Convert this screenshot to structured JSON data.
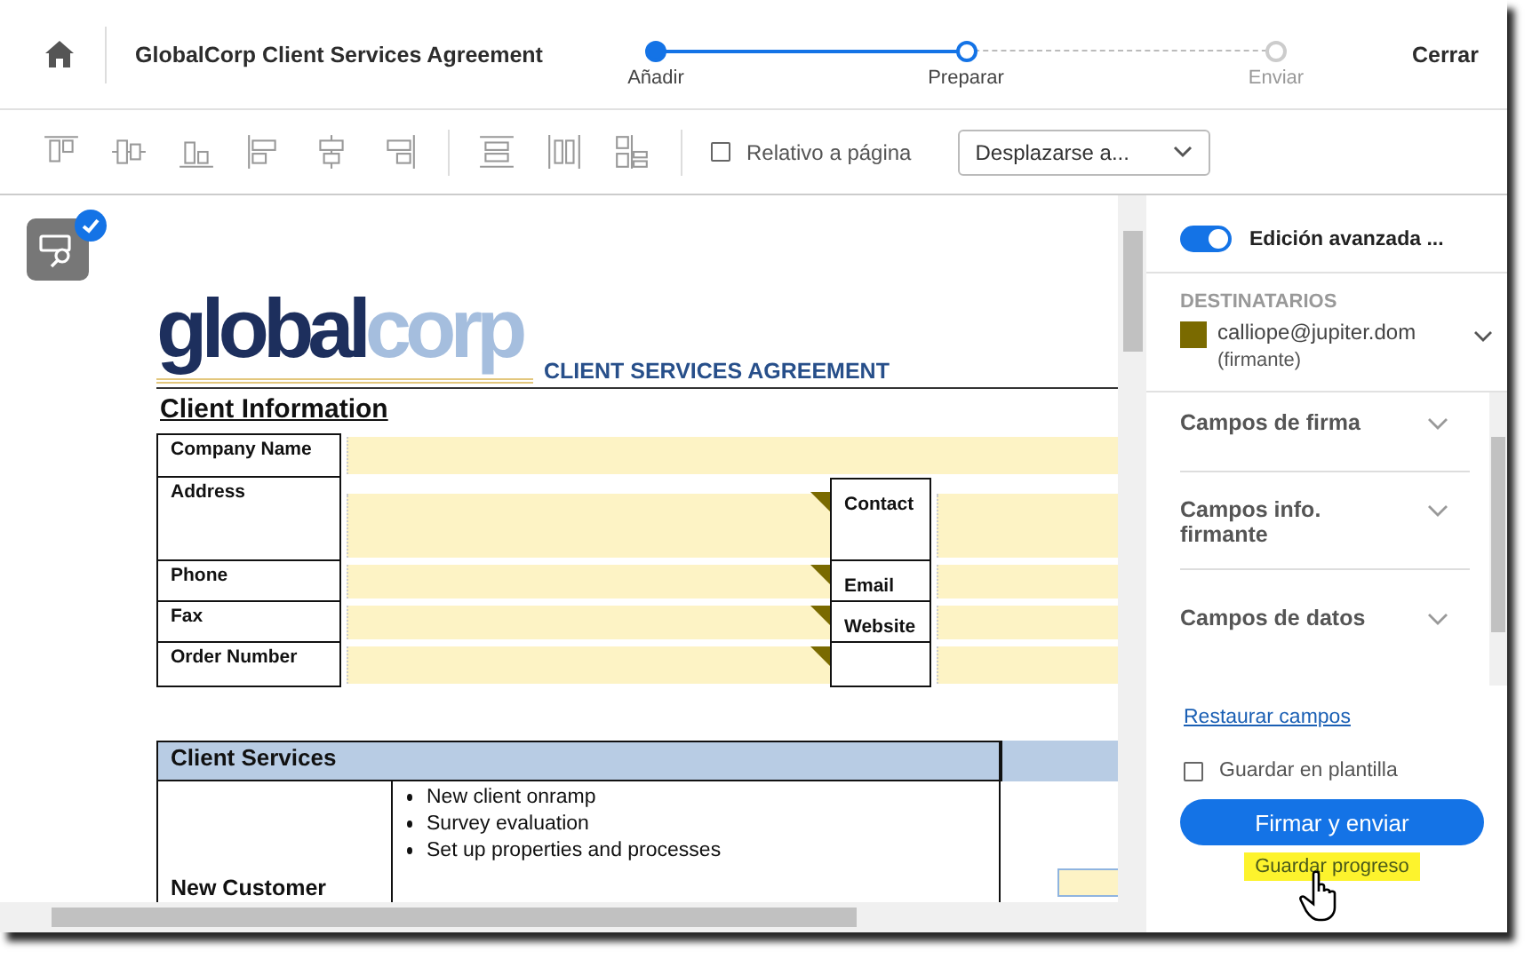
{
  "header": {
    "title": "GlobalCorp Client Services Agreement",
    "steps": [
      {
        "label": "Añadir",
        "completed": true,
        "selected": false
      },
      {
        "label": "Preparar",
        "completed": false,
        "selected": true
      },
      {
        "label": "Enviar",
        "completed": false,
        "selected": false
      }
    ],
    "close": "Cerrar"
  },
  "toolbar": {
    "relative_to_page": {
      "label": "Relativo a página",
      "checked": false
    },
    "scroll_to": {
      "value": "Desplazarse a..."
    }
  },
  "document": {
    "logo": {
      "part_1": "global",
      "part_2": "corp"
    },
    "heading": "CLIENT SERVICES AGREEMENT",
    "section_1": "Client Information",
    "fields": [
      {
        "kind": "wide",
        "label": "Company Name"
      },
      {
        "kind": "split",
        "label": "Address",
        "label_2": "Contact"
      },
      {
        "kind": "split",
        "label": "Phone",
        "label_2": "Email"
      },
      {
        "kind": "split",
        "label": "Fax",
        "label_2": "Website"
      },
      {
        "kind": "split",
        "label": "Order Number"
      }
    ],
    "section_2": "Client Services",
    "service_row": {
      "name": "New Customer",
      "items": [
        "New client onramp",
        "Survey evaluation",
        "Set up properties and processes"
      ]
    }
  },
  "panel": {
    "advanced_edit": {
      "label": "Edición avanzada ...",
      "on": true
    },
    "recipients_heading": "DESTINATARIOS",
    "recipients": [
      {
        "email": "calliope@jupiter.dom",
        "role": "(firmante)",
        "color": "#7a6a00"
      }
    ],
    "sections": [
      {
        "title": "Campos de firma",
        "expanded": false
      },
      {
        "title": "Campos info. firmante",
        "expanded": false
      },
      {
        "title": "Campos de datos",
        "expanded": false
      }
    ],
    "restore_link": "Restaurar campos",
    "save_template": {
      "label": "Guardar en plantilla",
      "checked": false
    },
    "primary_button": "Firmar y enviar",
    "save_progress": {
      "label": "Guardar progreso",
      "highlighted": true
    }
  }
}
